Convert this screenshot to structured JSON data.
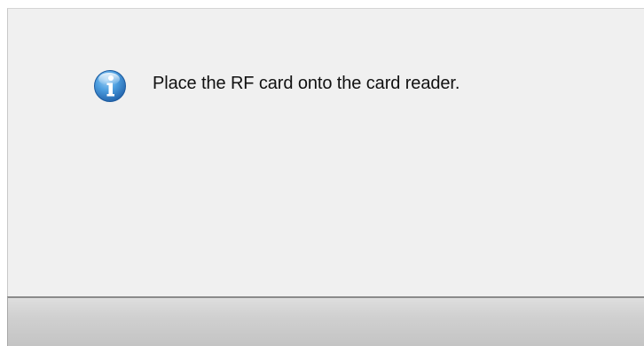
{
  "dialog": {
    "icon": "info-icon",
    "message": "Place the RF card onto the card reader.",
    "colors": {
      "body_background": "#f0f0f0",
      "icon_blue": "#2f7fc8",
      "button_bar": "#d0d0d0"
    }
  }
}
